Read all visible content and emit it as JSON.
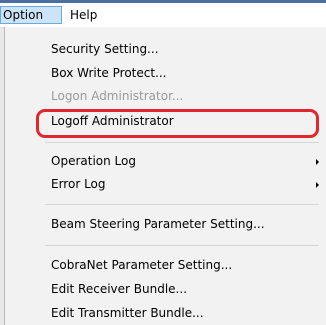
{
  "menubar": {
    "items": [
      {
        "label": "Option"
      },
      {
        "label": "Help"
      }
    ]
  },
  "dropdown": {
    "items": [
      {
        "label": "Security Setting..."
      },
      {
        "label": "Box Write Protect..."
      },
      {
        "label": "Logon Administrator..."
      },
      {
        "label": "Logoff Administrator"
      },
      {
        "label": "Operation Log"
      },
      {
        "label": "Error Log"
      },
      {
        "label": "Beam Steering Parameter Setting..."
      },
      {
        "label": "CobraNet Parameter Setting..."
      },
      {
        "label": "Edit Receiver Bundle..."
      },
      {
        "label": "Edit Transmitter Bundle..."
      }
    ]
  },
  "highlight": {
    "color": "#e2262e",
    "target": "Logoff Administrator"
  },
  "colors": {
    "menubar_active": "#cce4f7",
    "menu_bg": "#f2f2f2",
    "disabled_text": "#9a9a9a"
  }
}
